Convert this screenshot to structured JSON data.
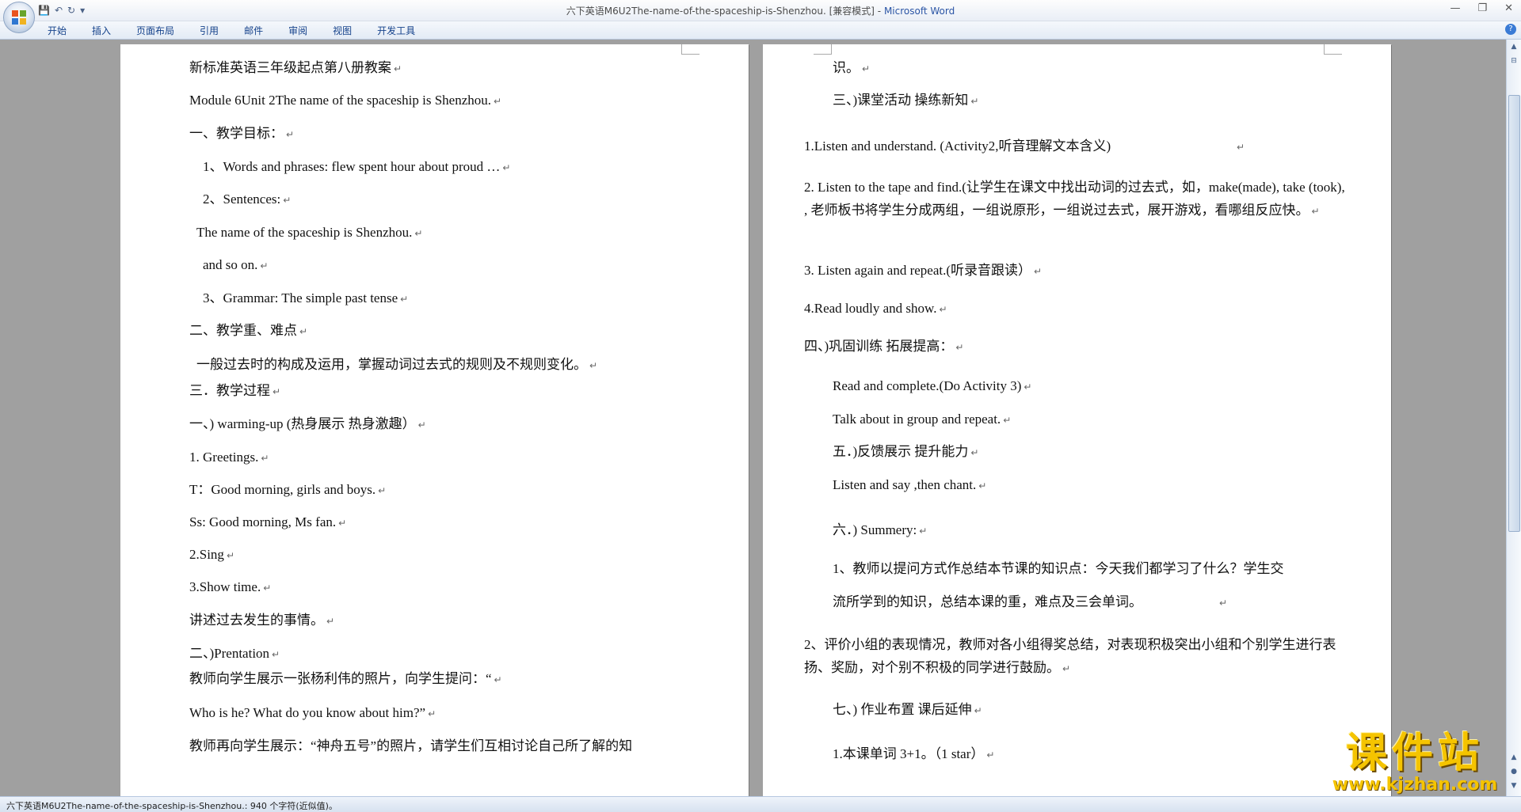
{
  "window": {
    "title_doc": "六下英语M6U2The-name-of-the-spaceship-is-Shenzhou. [兼容模式] - ",
    "title_app": "Microsoft Word",
    "controls": [
      "—",
      "❐",
      "✕"
    ]
  },
  "qat": {
    "save": "💾",
    "undo": "↶",
    "redo": "↻",
    "more": "▾"
  },
  "ribbon": {
    "tabs": [
      "开始",
      "插入",
      "页面布局",
      "引用",
      "邮件",
      "审阅",
      "视图",
      "开发工具"
    ],
    "help": "?"
  },
  "left_page": [
    "新标准英语三年级起点第八册教案",
    "Module 6Unit 2The name of the spaceship is Shenzhou.",
    "一、教学目标：",
    "1、Words and phrases: flew spent hour about proud …",
    "2、Sentences:",
    "The name of the spaceship is Shenzhou.",
    "and so on.",
    "3、Grammar: The simple past tense",
    "二、教学重、难点",
    "一般过去时的构成及运用，掌握动词过去式的规则及不规则变化。",
    "三．教学过程",
    "一、) warming-up (热身展示 热身激趣）",
    "1. Greetings.",
    "T：Good morning, girls and boys.",
    "Ss: Good morning, Ms fan.",
    "2.Sing",
    "3.Show time.",
    "讲述过去发生的事情。",
    "二、)Prentation",
    "教师向学生展示一张杨利伟的照片，向学生提问：“",
    "Who is he? What do you know about him?”",
    "教师再向学生展示：“神舟五号”的照片，请学生们互相讨论自己所了解的知"
  ],
  "right_page": {
    "l1": "识。",
    "l2": "三、)课堂活动 操练新知",
    "l3": "1.Listen and understand. (Activity2,听音理解文本含义)",
    "p4": "2. Listen to the tape and find.(让学生在课文中找出动词的过去式，如，make(made), take (took), , 老师板书将学生分成两组，一组说原形，一组说过去式，展开游戏，看哪组反应快。",
    "l5": "3. Listen again and repeat.(听录音跟读）",
    "l6": "4.Read loudly and show.",
    "l7": "四、)巩固训练 拓展提高：",
    "l8": "Read and complete.(Do Activity 3)",
    "l9": "Talk about in group and repeat.",
    "l10": "五．)反馈展示 提升能力",
    "l11": "Listen and say ,then chant.",
    "l12": "六．) Summery:",
    "l13": "1、教师以提问方式作总结本节课的知识点：今天我们都学习了什么？学生交",
    "l14": "流所学到的知识，总结本课的重，难点及三会单词。",
    "p15": "2、评价小组的表现情况，教师对各小组得奖总结，对表现积极突出小组和个别学生进行表扬、奖励，对个别不积极的同学进行鼓励。",
    "l16": "七、) 作业布置 课后延伸",
    "l17": "1.本课单词 3+1。（1 star）"
  },
  "para_mark": "↵",
  "statusbar": {
    "text": "六下英语M6U2The-name-of-the-spaceship-is-Shenzhou.: 940 个字符(近似值)。"
  },
  "watermark": {
    "main": "课件站",
    "sub": "www.kjzhan.com"
  }
}
